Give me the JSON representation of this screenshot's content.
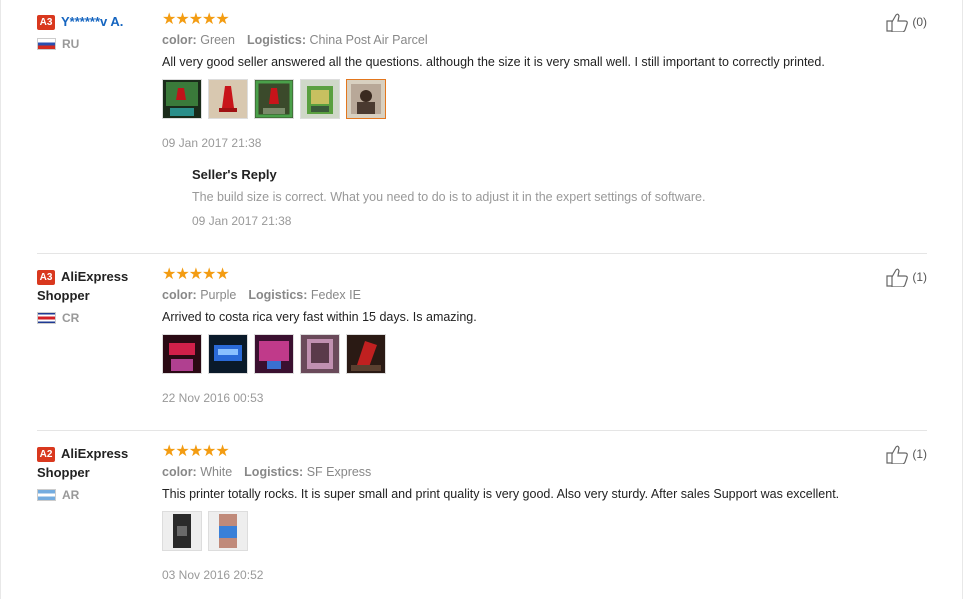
{
  "reviews": [
    {
      "level": "A3",
      "user": "Y******v A.",
      "country": "RU",
      "stars": "★★★★★",
      "color_label": "color:",
      "color_value": "Green",
      "logistics_label": "Logistics:",
      "logistics_value": "China Post Air Parcel",
      "text": "All very good seller answered all the questions. although the size it is very small well. I still important to correctly printed.",
      "date": "09 Jan 2017 21:38",
      "helpful": "(0)",
      "reply": {
        "title": "Seller's Reply",
        "text": "The build size is correct. What you need to do is to adjust it in the expert settings of software.",
        "date": "09 Jan 2017 21:38"
      }
    },
    {
      "level": "A3",
      "user": "AliExpress Shopper",
      "country": "CR",
      "stars": "★★★★★",
      "color_label": "color:",
      "color_value": "Purple",
      "logistics_label": "Logistics:",
      "logistics_value": "Fedex IE",
      "text": "Arrived to costa rica very fast within 15 days. Is amazing.",
      "date": "22 Nov 2016 00:53",
      "helpful": "(1)"
    },
    {
      "level": "A2",
      "user": "AliExpress Shopper",
      "country": "AR",
      "stars": "★★★★★",
      "color_label": "color:",
      "color_value": "White",
      "logistics_label": "Logistics:",
      "logistics_value": "SF Express",
      "text": "This printer totally rocks. It is super small and print quality is very good. Also very sturdy. After sales Support was excellent.",
      "date": "03 Nov 2016 20:52",
      "helpful": "(1)"
    }
  ],
  "colors": {
    "star": "#f39c12",
    "level_badge": "#d9381e",
    "selected_thumb": "#e3771e",
    "link": "#1565c0"
  }
}
